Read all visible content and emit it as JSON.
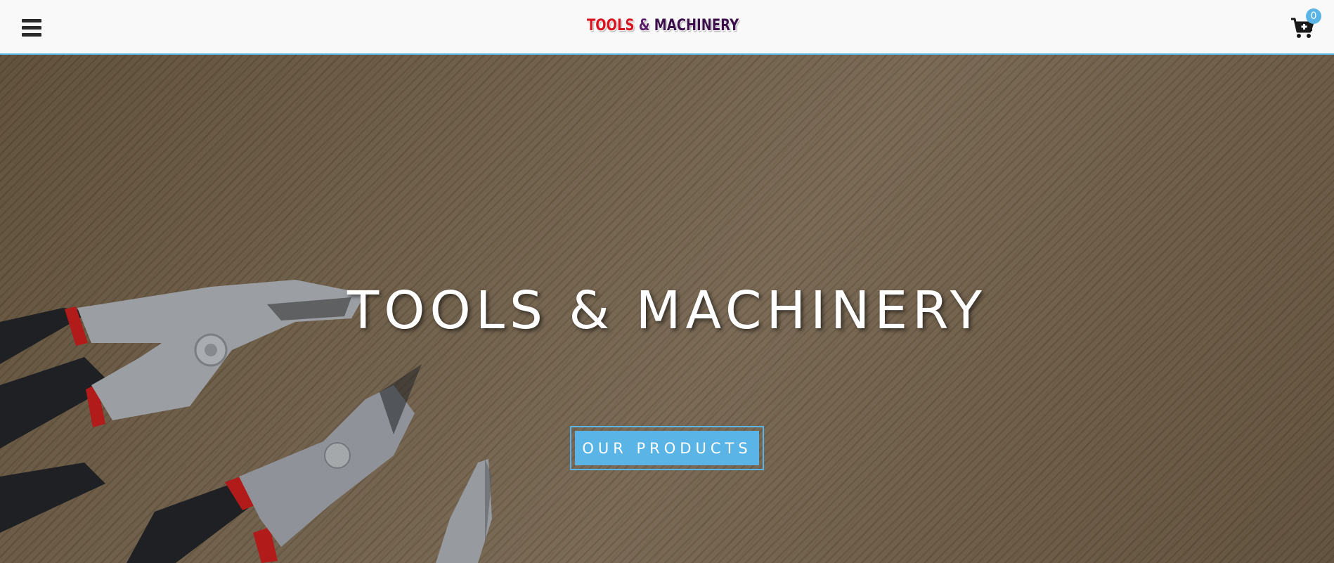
{
  "header": {
    "logo": {
      "word1": "TOOLS",
      "word2": "&",
      "word3": "MACHINERY"
    },
    "cart_count": "0",
    "menu_icon": "hamburger-menu-icon",
    "cart_icon": "shopping-cart-plus-icon"
  },
  "hero": {
    "title": "TOOLS & MACHINERY",
    "cta_label": "OUR PRODUCTS"
  },
  "colors": {
    "accent": "#5ab4e5",
    "logo_red": "#d8121f",
    "logo_purple": "#3a0f4a",
    "header_bg": "#f9f9f9"
  }
}
